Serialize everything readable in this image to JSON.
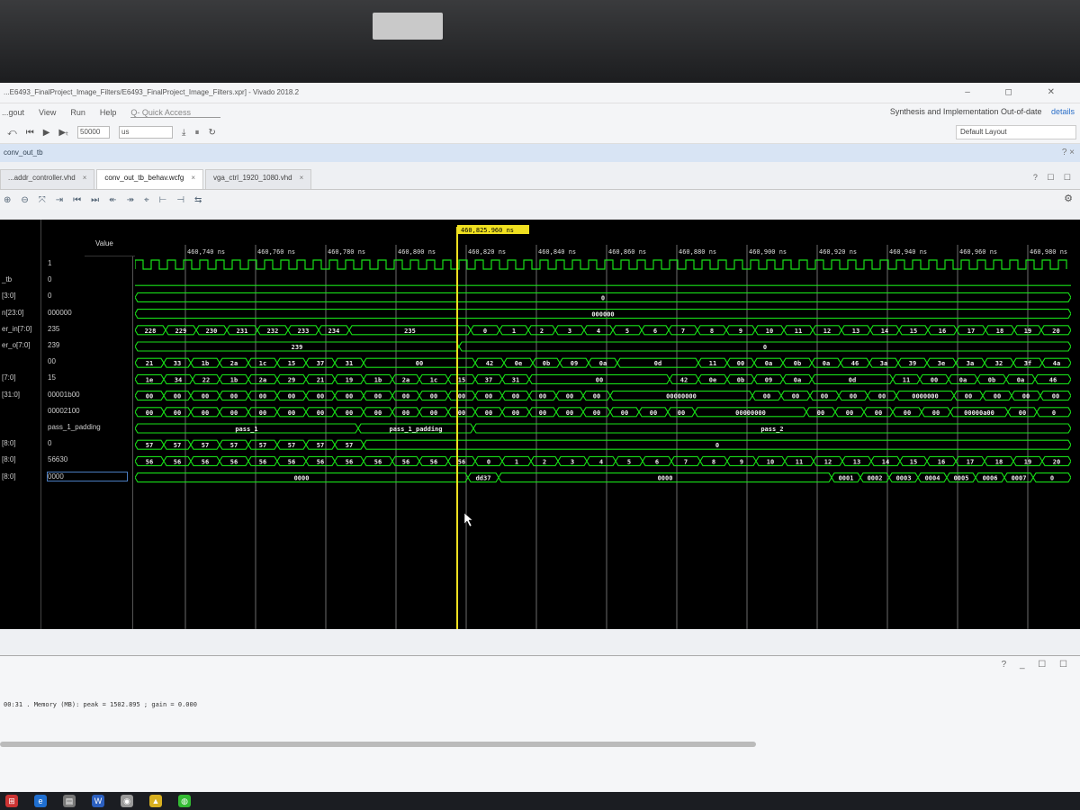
{
  "window": {
    "title": "...E6493_FinalProject_Image_Filters/E6493_FinalProject_Image_Filters.xpr] - Vivado 2018.2",
    "controls": "–  ◻  ✕"
  },
  "menu": {
    "items": [
      "...gout",
      "View",
      "Run",
      "Help"
    ],
    "quick_access": "Q- Quick Access",
    "status_text": "Synthesis and Implementation Out-of-date",
    "status_link": "details"
  },
  "toolbar": {
    "run_time_value": "50000",
    "run_time_unit": "us",
    "layout": "Default Layout"
  },
  "breadcrumb": "conv_out_tb",
  "tabs": [
    {
      "label": "...addr_controller.vhd"
    },
    {
      "label": "conv_out_tb_behav.wcfg"
    },
    {
      "label": "vga_ctrl_1920_1080.vhd"
    }
  ],
  "wave_viewer": {
    "value_header": "Value",
    "cursor_label": "460,825.960 ns",
    "time_ticks": [
      "460,740 ns",
      "460,760 ns",
      "460,780 ns",
      "460,800 ns",
      "460,820 ns",
      "460,840 ns",
      "460,860 ns",
      "460,880 ns",
      "460,900 ns",
      "460,920 ns",
      "460,940 ns",
      "460,960 ns",
      "460,980 ns"
    ],
    "signal_names": [
      "",
      "_tb",
      "[3:0]",
      "n[23:0]",
      "er_in[7:0]",
      "er_o[7:0]",
      "",
      "[7:0]",
      "[31:0]",
      "",
      "",
      "[8:0]",
      "[8:0]",
      "[8:0]"
    ],
    "signal_values": [
      "1",
      "0",
      "0",
      "000000",
      "235",
      "239",
      "00",
      "15",
      "00001b00",
      "00002100",
      "pass_1_padding",
      "0",
      "56630",
      "0000"
    ],
    "rows": [
      {
        "kind": "clock"
      },
      {
        "kind": "low"
      },
      {
        "kind": "bus",
        "segs": [
          [
            "0",
            0,
            1040
          ]
        ]
      },
      {
        "kind": "bus",
        "segs": [
          [
            "000000",
            0,
            1040
          ]
        ]
      },
      {
        "kind": "bus",
        "segs": [
          [
            "228",
            0,
            34
          ],
          [
            "229",
            34,
            34
          ],
          [
            "230",
            68,
            34
          ],
          [
            "231",
            102,
            34
          ],
          [
            "232",
            136,
            34
          ],
          [
            "233",
            170,
            34
          ],
          [
            "234",
            204,
            34
          ],
          [
            "235",
            238,
            135
          ],
          [
            "0",
            373,
            32
          ],
          [
            "1",
            405,
            32
          ],
          [
            "2",
            437,
            30
          ],
          [
            "3",
            467,
            32
          ],
          [
            "4",
            499,
            32
          ],
          [
            "5",
            531,
            32
          ],
          [
            "6",
            563,
            30
          ],
          [
            "7",
            593,
            32
          ],
          [
            "8",
            625,
            32
          ],
          [
            "9",
            657,
            32
          ],
          [
            "10",
            689,
            32
          ],
          [
            "11",
            721,
            32
          ],
          [
            "12",
            753,
            32
          ],
          [
            "13",
            785,
            32
          ],
          [
            "14",
            817,
            32
          ],
          [
            "15",
            849,
            32
          ],
          [
            "16",
            881,
            32
          ],
          [
            "17",
            913,
            32
          ],
          [
            "18",
            945,
            32
          ],
          [
            "19",
            977,
            30
          ],
          [
            "20",
            1007,
            33
          ]
        ]
      },
      {
        "kind": "bus",
        "segs": [
          [
            "239",
            0,
            360
          ],
          [
            "0",
            360,
            680
          ]
        ]
      },
      {
        "kind": "bus",
        "segs": [
          [
            "21",
            0,
            32
          ],
          [
            "33",
            32,
            30
          ],
          [
            "1b",
            62,
            32
          ],
          [
            "2a",
            94,
            32
          ],
          [
            "1c",
            126,
            32
          ],
          [
            "15",
            158,
            32
          ],
          [
            "37",
            190,
            32
          ],
          [
            "31",
            222,
            32
          ],
          [
            "00",
            254,
            124
          ],
          [
            "42",
            378,
            32
          ],
          [
            "0e",
            410,
            32
          ],
          [
            "0b",
            442,
            30
          ],
          [
            "09",
            472,
            32
          ],
          [
            "0a",
            504,
            32
          ],
          [
            "0d",
            536,
            90
          ],
          [
            "11",
            626,
            32
          ],
          [
            "00",
            658,
            30
          ],
          [
            "0a",
            688,
            32
          ],
          [
            "0b",
            720,
            32
          ],
          [
            "0a",
            752,
            32
          ],
          [
            "46",
            784,
            32
          ],
          [
            "3a",
            816,
            32
          ],
          [
            "39",
            848,
            32
          ],
          [
            "3e",
            880,
            32
          ],
          [
            "3a",
            912,
            32
          ],
          [
            "32",
            944,
            32
          ],
          [
            "3f",
            976,
            32
          ],
          [
            "4a",
            1008,
            32
          ]
        ]
      },
      {
        "kind": "bus",
        "segs": [
          [
            "1e",
            0,
            32
          ],
          [
            "34",
            32,
            32
          ],
          [
            "22",
            64,
            30
          ],
          [
            "1b",
            94,
            32
          ],
          [
            "2a",
            126,
            32
          ],
          [
            "29",
            158,
            32
          ],
          [
            "21",
            190,
            32
          ],
          [
            "19",
            222,
            32
          ],
          [
            "1b",
            254,
            32
          ],
          [
            "2a",
            286,
            30
          ],
          [
            "1c",
            316,
            32
          ],
          [
            "15",
            348,
            30
          ],
          [
            "37",
            378,
            30
          ],
          [
            "31",
            408,
            30
          ],
          [
            "00",
            438,
            156
          ],
          [
            "42",
            594,
            32
          ],
          [
            "0e",
            626,
            32
          ],
          [
            "0b",
            658,
            30
          ],
          [
            "09",
            688,
            32
          ],
          [
            "0a",
            720,
            32
          ],
          [
            "0d",
            752,
            90
          ],
          [
            "11",
            842,
            30
          ],
          [
            "00",
            872,
            32
          ],
          [
            "0a",
            904,
            32
          ],
          [
            "0b",
            936,
            32
          ],
          [
            "0a",
            968,
            32
          ],
          [
            "46",
            1000,
            40
          ]
        ]
      },
      {
        "kind": "bus",
        "segs": [
          [
            "00",
            0,
            32
          ],
          [
            "00",
            32,
            30
          ],
          [
            "00",
            62,
            32
          ],
          [
            "00",
            94,
            32
          ],
          [
            "00",
            126,
            32
          ],
          [
            "00",
            158,
            32
          ],
          [
            "00",
            190,
            32
          ],
          [
            "00",
            222,
            32
          ],
          [
            "00",
            254,
            32
          ],
          [
            "00",
            286,
            30
          ],
          [
            "00",
            316,
            32
          ],
          [
            "00",
            348,
            30
          ],
          [
            "00",
            378,
            30
          ],
          [
            "00",
            408,
            30
          ],
          [
            "00",
            438,
            30
          ],
          [
            "00",
            468,
            30
          ],
          [
            "00",
            498,
            30
          ],
          [
            "00000000",
            528,
            158
          ],
          [
            "00",
            686,
            32
          ],
          [
            "00",
            718,
            32
          ],
          [
            "00",
            750,
            32
          ],
          [
            "00",
            782,
            32
          ],
          [
            "00",
            814,
            32
          ],
          [
            "0000000",
            846,
            64
          ],
          [
            "00",
            910,
            32
          ],
          [
            "00",
            942,
            32
          ],
          [
            "00",
            974,
            32
          ],
          [
            "00",
            1006,
            34
          ]
        ]
      },
      {
        "kind": "bus",
        "segs": [
          [
            "00",
            0,
            32
          ],
          [
            "00",
            32,
            30
          ],
          [
            "00",
            62,
            32
          ],
          [
            "00",
            94,
            32
          ],
          [
            "00",
            126,
            32
          ],
          [
            "00",
            158,
            32
          ],
          [
            "00",
            190,
            32
          ],
          [
            "00",
            222,
            32
          ],
          [
            "00",
            254,
            32
          ],
          [
            "00",
            286,
            30
          ],
          [
            "00",
            316,
            32
          ],
          [
            "00",
            348,
            30
          ],
          [
            "00",
            378,
            30
          ],
          [
            "00",
            408,
            30
          ],
          [
            "00",
            438,
            30
          ],
          [
            "00",
            468,
            30
          ],
          [
            "00",
            498,
            30
          ],
          [
            "00",
            528,
            32
          ],
          [
            "00",
            560,
            32
          ],
          [
            "00",
            592,
            30
          ],
          [
            "00000000",
            622,
            124
          ],
          [
            "00",
            746,
            32
          ],
          [
            "00",
            778,
            32
          ],
          [
            "00",
            810,
            32
          ],
          [
            "00",
            842,
            32
          ],
          [
            "00",
            874,
            32
          ],
          [
            "00000a00",
            906,
            64
          ],
          [
            "00",
            970,
            32
          ],
          [
            "0",
            1002,
            38
          ]
        ]
      },
      {
        "kind": "bus",
        "segs": [
          [
            "pass_1",
            0,
            248
          ],
          [
            "pass_1_padding",
            248,
            128
          ],
          [
            "pass_2",
            376,
            664
          ]
        ]
      },
      {
        "kind": "bus",
        "segs": [
          [
            "57",
            0,
            32
          ],
          [
            "57",
            32,
            30
          ],
          [
            "57",
            62,
            32
          ],
          [
            "57",
            94,
            32
          ],
          [
            "57",
            126,
            32
          ],
          [
            "57",
            158,
            32
          ],
          [
            "57",
            190,
            32
          ],
          [
            "57",
            222,
            32
          ],
          [
            "0",
            254,
            786
          ]
        ]
      },
      {
        "kind": "bus",
        "segs": [
          [
            "56",
            0,
            32
          ],
          [
            "56",
            32,
            30
          ],
          [
            "56",
            62,
            32
          ],
          [
            "56",
            94,
            32
          ],
          [
            "56",
            126,
            32
          ],
          [
            "56",
            158,
            32
          ],
          [
            "56",
            190,
            32
          ],
          [
            "56",
            222,
            32
          ],
          [
            "56",
            254,
            32
          ],
          [
            "56",
            286,
            30
          ],
          [
            "56",
            316,
            32
          ],
          [
            "56",
            348,
            30
          ],
          [
            "0",
            378,
            30
          ],
          [
            "1",
            408,
            32
          ],
          [
            "2",
            440,
            30
          ],
          [
            "3",
            470,
            32
          ],
          [
            "4",
            502,
            32
          ],
          [
            "5",
            534,
            30
          ],
          [
            "6",
            564,
            32
          ],
          [
            "7",
            596,
            32
          ],
          [
            "8",
            628,
            30
          ],
          [
            "9",
            658,
            32
          ],
          [
            "10",
            690,
            32
          ],
          [
            "11",
            722,
            32
          ],
          [
            "12",
            754,
            32
          ],
          [
            "13",
            786,
            32
          ],
          [
            "14",
            818,
            32
          ],
          [
            "15",
            850,
            30
          ],
          [
            "16",
            880,
            32
          ],
          [
            "17",
            912,
            32
          ],
          [
            "18",
            944,
            32
          ],
          [
            "19",
            976,
            32
          ],
          [
            "20",
            1008,
            32
          ]
        ]
      },
      {
        "kind": "bus",
        "segs": [
          [
            "0000",
            0,
            370
          ],
          [
            "dd37",
            370,
            34
          ],
          [
            "0000",
            404,
            370
          ],
          [
            "0001",
            774,
            32
          ],
          [
            "0002",
            806,
            32
          ],
          [
            "0003",
            838,
            32
          ],
          [
            "0004",
            870,
            32
          ],
          [
            "0005",
            902,
            32
          ],
          [
            "0006",
            934,
            32
          ],
          [
            "0007",
            966,
            32
          ],
          [
            "0",
            998,
            42
          ]
        ]
      }
    ]
  },
  "console": {
    "text": "00:31 . Memory (MB): peak = 1502.895 ; gain = 0.000",
    "controls": "? _ ☐ ☐"
  },
  "colors": {
    "wave": "#18e018",
    "cursor": "#f0e020",
    "background": "#000000",
    "accent": "#2b6fc8"
  },
  "taskbar": {
    "icons": [
      "windows-icon",
      "edge-icon",
      "explorer-icon",
      "word-icon",
      "chrome-icon",
      "vivado-icon",
      "wechat-icon"
    ]
  }
}
